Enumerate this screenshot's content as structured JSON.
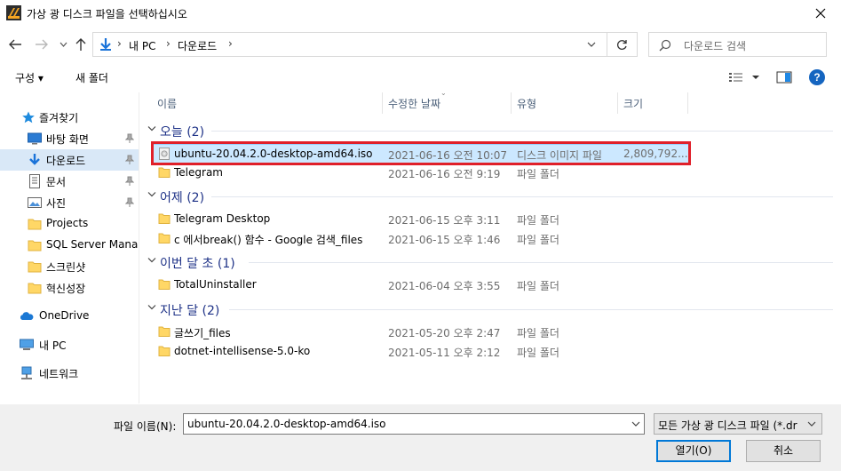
{
  "window": {
    "title": "가상 광 디스크 파일을 선택하십시오",
    "close_glyph": "✕"
  },
  "address": {
    "breadcrumbs": [
      "내 PC",
      "다운로드"
    ],
    "search_placeholder": "다운로드 검색"
  },
  "toolbar": {
    "organize_label": "구성 ▾",
    "new_folder_label": "새 폴더"
  },
  "sidebar": {
    "items": [
      {
        "label": "즐겨찾기",
        "icon": "star-icon"
      },
      {
        "label": "바탕 화면",
        "icon": "desktop-icon"
      },
      {
        "label": "다운로드",
        "icon": "download-icon"
      },
      {
        "label": "문서",
        "icon": "document-icon"
      },
      {
        "label": "사진",
        "icon": "picture-icon"
      },
      {
        "label": "Projects",
        "icon": "folder-icon"
      },
      {
        "label": "SQL Server Manage",
        "icon": "folder-icon"
      },
      {
        "label": "스크린샷",
        "icon": "folder-icon"
      },
      {
        "label": "혁신성장",
        "icon": "folder-icon"
      },
      {
        "label": "OneDrive",
        "icon": "cloud-icon"
      },
      {
        "label": "내 PC",
        "icon": "computer-icon"
      },
      {
        "label": "네트워크",
        "icon": "network-icon"
      }
    ]
  },
  "columns": {
    "name": "이름",
    "date": "수정한 날짜",
    "type": "유형",
    "size": "크기"
  },
  "groups": [
    {
      "label": "오늘 (2)",
      "files": [
        {
          "name": "ubuntu-20.04.2.0-desktop-amd64.iso",
          "date": "2021-06-16 오전 10:07",
          "type": "디스크 이미지 파일",
          "size": "2,809,792...",
          "icon": "disk-image-icon"
        },
        {
          "name": "Telegram",
          "date": "2021-06-16 오전 9:19",
          "type": "파일 폴더",
          "size": "",
          "icon": "folder-icon"
        }
      ]
    },
    {
      "label": "어제 (2)",
      "files": [
        {
          "name": "Telegram Desktop",
          "date": "2021-06-15 오후 3:11",
          "type": "파일 폴더",
          "size": "",
          "icon": "folder-icon"
        },
        {
          "name": "c 에서break() 함수 - Google 검색_files",
          "date": "2021-06-15 오후 1:46",
          "type": "파일 폴더",
          "size": "",
          "icon": "folder-icon"
        }
      ]
    },
    {
      "label": "이번 달 초 (1)",
      "files": [
        {
          "name": "TotalUninstaller",
          "date": "2021-06-04 오후 3:55",
          "type": "파일 폴더",
          "size": "",
          "icon": "folder-icon"
        }
      ]
    },
    {
      "label": "지난 달 (2)",
      "files": [
        {
          "name": "글쓰기_files",
          "date": "2021-05-20 오후 2:47",
          "type": "파일 폴더",
          "size": "",
          "icon": "folder-icon"
        },
        {
          "name": "dotnet-intellisense-5.0-ko",
          "date": "2021-05-11 오후 2:12",
          "type": "파일 폴더",
          "size": "",
          "icon": "folder-icon"
        }
      ]
    }
  ],
  "bottom": {
    "filename_label": "파일 이름(N):",
    "filename_value": "ubuntu-20.04.2.0-desktop-amd64.iso",
    "filter_value": "모든 가상 광 디스크 파일 (*.dr",
    "open_label": "열기(O)",
    "cancel_label": "취소"
  },
  "colors": {
    "selection_bg": "#cce8ff",
    "highlight_border": "#e0202a",
    "group_text": "#1e3287",
    "folder": "#ffd766",
    "accent": "#0078d7"
  }
}
